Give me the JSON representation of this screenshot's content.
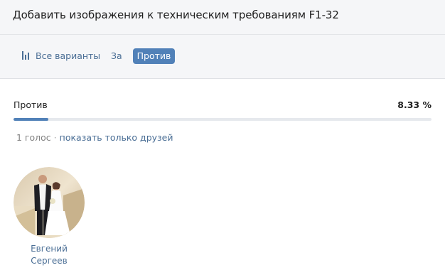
{
  "header": {
    "title": "Добавить изображения к техническим требованиям F1-32"
  },
  "tabs": {
    "all": {
      "label": "Все варианты",
      "icon": "bar-chart-icon"
    },
    "za": {
      "label": "За"
    },
    "protiv": {
      "label": "Против",
      "active": true
    }
  },
  "result": {
    "label": "Против",
    "percent_text": "8.33 %",
    "percent_value": 8.33
  },
  "meta": {
    "votes": "1 голос",
    "separator": "·",
    "friends_link": "показать только друзей"
  },
  "voters": [
    {
      "name_first": "Евгений",
      "name_last": "Сергеев"
    }
  ],
  "colors": {
    "accent": "#5181b8",
    "link": "#4a6e95",
    "header_bg": "#f5f6f8"
  }
}
